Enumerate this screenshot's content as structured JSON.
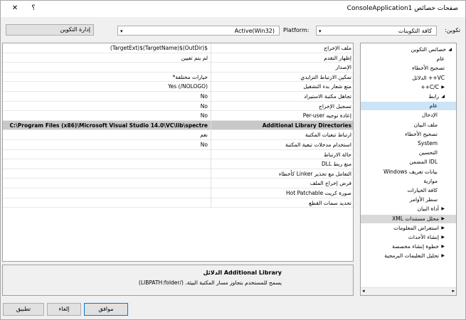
{
  "window": {
    "title": "صفحات خصائص ConsoleApplication1",
    "help": "؟",
    "close": "✕"
  },
  "toolbar": {
    "config_label": "تكوين:",
    "config_value": "كافة التكوينات",
    "platform_label": "Platform:",
    "platform_value": "Active(Win32)",
    "manager_button": "إدارة التكوين"
  },
  "tree": {
    "items": [
      {
        "label": "خصائص التكوين",
        "expander": "◢"
      },
      {
        "label": "عام"
      },
      {
        "label": "تصحيح الأخطاء"
      },
      {
        "label": "VC++ الدلائل"
      },
      {
        "label": "C/C++",
        "expander": "▶"
      },
      {
        "label": "رابط",
        "expander": "◢"
      },
      {
        "label": "عام"
      },
      {
        "label": "الإدخال"
      },
      {
        "label": "ملف البيان"
      },
      {
        "label": "تصحيح الأخطاء"
      },
      {
        "label": "System"
      },
      {
        "label": "التحسين"
      },
      {
        "label": "IDL المضمن"
      },
      {
        "label": "بيانات تعريف Windows"
      },
      {
        "label": "موازية"
      },
      {
        "label": "كافة الخيارات"
      },
      {
        "label": "سطر الأوامر"
      },
      {
        "label": "أداة البيان",
        "expander": "▶"
      },
      {
        "label": "محلل مستندات XML",
        "expander": "▶"
      },
      {
        "label": "استعراض المعلومات",
        "expander": "▶"
      },
      {
        "label": "إنشاء الأحداث",
        "expander": "▶"
      },
      {
        "label": "خطوة إنشاء مخصصة",
        "expander": "▶"
      },
      {
        "label": "تحليل التعليمات البرمجية",
        "expander": "▶"
      }
    ]
  },
  "grid": {
    "rows": [
      {
        "name": "ملف الإخراج",
        "value": "$(OutDir)$(TargetName)$(TargetExt)"
      },
      {
        "name": "إظهار التقدم",
        "value": "لم يتم تعيين"
      },
      {
        "name": "الإصدار",
        "value": ""
      },
      {
        "name": "تمكين الارتباط التزايدي",
        "value": "خيارات مختلفة*"
      },
      {
        "name": "منع شعار بدء التشغيل",
        "value": "Yes (/NOLOGO)"
      },
      {
        "name": "تجاهل مكتبة الاستيراد",
        "value": "No"
      },
      {
        "name": "تسجيل الإخراج",
        "value": "No"
      },
      {
        "name": "إعادة توجيه Per-user",
        "value": "No"
      },
      {
        "name": "Additional Library Directories",
        "value": "C:\\Program Files (x86)\\Microsoft Visual Studio 14.0\\VC\\lib\\spectre",
        "category": true
      },
      {
        "name": "ارتباط تبعيات المكتبة",
        "value": "نعم"
      },
      {
        "name": "استخدام مدخلات تبعية المكتبة",
        "value": "No"
      },
      {
        "name": "حالة الارتباط",
        "value": ""
      },
      {
        "name": "منع ربط DLL",
        "value": ""
      },
      {
        "name": "التعامل مع تحذير Linker كأخطاء",
        "value": ""
      },
      {
        "name": "فرض إخراج الملف",
        "value": ""
      },
      {
        "name": "صورة كريت Hot Patchable",
        "value": ""
      },
      {
        "name": "تحديد سمات القطع",
        "value": ""
      }
    ]
  },
  "description": {
    "title": "Additional Library الدلائل",
    "text": "يسمح للمستخدم بتجاوز مسار المكتبة البيئة. (/LIBPATH:folder)"
  },
  "buttons": {
    "ok": "موافق",
    "cancel": "إلغاء",
    "apply": "تطبيق"
  }
}
